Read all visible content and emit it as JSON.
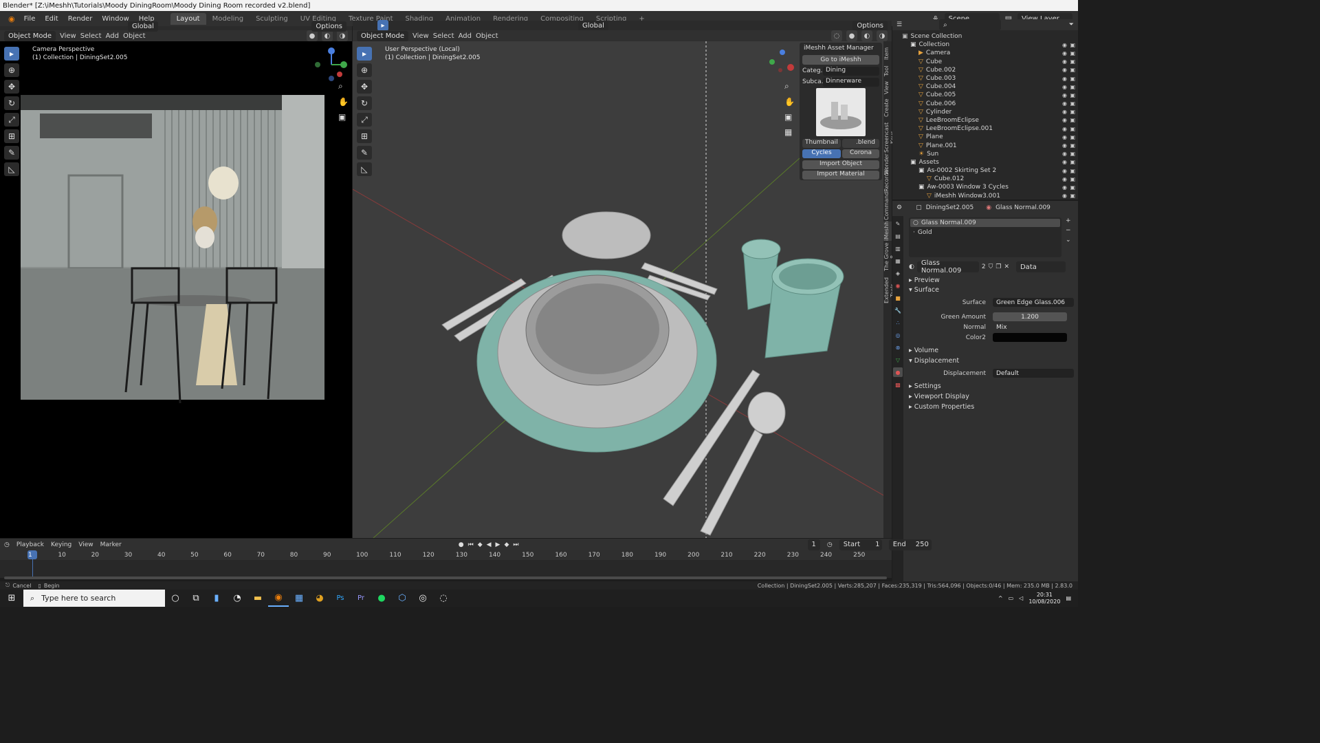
{
  "titlebar": {
    "title": "Blender* [Z:\\iMeshh\\Tutorials\\Moody DiningRoom\\Moody Dining Room recorded v2.blend]",
    "minimize": "—",
    "restore": "❐",
    "close": "✕"
  },
  "menu": [
    "File",
    "Edit",
    "Render",
    "Window",
    "Help"
  ],
  "workspaces": [
    "Layout",
    "Modeling",
    "Sculpting",
    "UV Editing",
    "Texture Paint",
    "Shading",
    "Animation",
    "Rendering",
    "Compositing",
    "Scripting"
  ],
  "active_workspace": "Layout",
  "add_workspace": "+",
  "scene": {
    "label": "Scene",
    "view_layer": "View Layer"
  },
  "left_viewport": {
    "mode": "Object Mode",
    "menus": [
      "View",
      "Select",
      "Add",
      "Object"
    ],
    "transform": "Global",
    "options": "Options",
    "title": "Camera Perspective",
    "subtitle": "(1) Collection | DiningSet2.005"
  },
  "right_viewport": {
    "mode": "Object Mode",
    "menus": [
      "View",
      "Select",
      "Add",
      "Object"
    ],
    "transform": "Global",
    "options": "Options",
    "title": "User Perspective (Local)",
    "subtitle": "(1) Collection | DiningSet2.005"
  },
  "asset_manager": {
    "title": "iMeshh Asset Manager",
    "goto": "Go to iMeshh",
    "category_label": "Categ...",
    "category_value": "Dining",
    "subcategory_label": "Subca...",
    "subcategory_value": "Dinnerware",
    "thumbnail_btn": "Thumbnail",
    "blend_btn": ".blend",
    "engine_cycles": "Cycles",
    "engine_corona": "Corona",
    "import_object": "Import Object",
    "import_material": "Import Material"
  },
  "sidebar_tabs": [
    "Item",
    "Tool",
    "View",
    "Create",
    "Screencast Keys",
    "Wonder",
    "CommandRecorder",
    "iMeshh",
    "The Grove 8",
    "Extended Tools"
  ],
  "outliner": {
    "root": "Scene Collection",
    "items": [
      {
        "name": "Collection",
        "depth": 1,
        "icon": "collection-icon"
      },
      {
        "name": "Camera",
        "depth": 2,
        "icon": "camera-icon"
      },
      {
        "name": "Cube",
        "depth": 2,
        "icon": "mesh-icon"
      },
      {
        "name": "Cube.002",
        "depth": 2,
        "icon": "mesh-icon"
      },
      {
        "name": "Cube.003",
        "depth": 2,
        "icon": "mesh-icon"
      },
      {
        "name": "Cube.004",
        "depth": 2,
        "icon": "mesh-icon"
      },
      {
        "name": "Cube.005",
        "depth": 2,
        "icon": "mesh-icon"
      },
      {
        "name": "Cube.006",
        "depth": 2,
        "icon": "mesh-icon"
      },
      {
        "name": "Cylinder",
        "depth": 2,
        "icon": "mesh-icon"
      },
      {
        "name": "LeeBroomEclipse",
        "depth": 2,
        "icon": "mesh-icon"
      },
      {
        "name": "LeeBroomEclipse.001",
        "depth": 2,
        "icon": "mesh-icon"
      },
      {
        "name": "Plane",
        "depth": 2,
        "icon": "mesh-icon"
      },
      {
        "name": "Plane.001",
        "depth": 2,
        "icon": "mesh-icon"
      },
      {
        "name": "Sun",
        "depth": 2,
        "icon": "light-icon"
      },
      {
        "name": "Assets",
        "depth": 1,
        "icon": "collection-icon"
      },
      {
        "name": "As-0002 Skirting Set 2",
        "depth": 2,
        "icon": "collection-icon"
      },
      {
        "name": "Cube.012",
        "depth": 3,
        "icon": "mesh-icon"
      },
      {
        "name": "Aw-0003 Window 3 Cycles",
        "depth": 2,
        "icon": "collection-icon"
      },
      {
        "name": "iMeshh Window3.001",
        "depth": 3,
        "icon": "mesh-icon"
      }
    ]
  },
  "properties": {
    "object": "DiningSet2.005",
    "material": "Glass Normal.009",
    "slots": [
      "Glass Normal.009",
      "Gold"
    ],
    "material_field": "Glass Normal.009",
    "users": "2",
    "link": "Data",
    "preview": "Preview",
    "surface_section": "Surface",
    "surface_label": "Surface",
    "surface_value": "Green Edge Glass.006",
    "green_label": "Green Amount",
    "green_value": "1.200",
    "normal_label": "Normal",
    "normal_value": "Mix",
    "color2_label": "Color2",
    "volume": "Volume",
    "displacement_section": "Displacement",
    "displacement_label": "Displacement",
    "displacement_value": "Default",
    "settings": "Settings",
    "viewport_display": "Viewport Display",
    "custom_properties": "Custom Properties"
  },
  "timeline": {
    "menus": [
      "Playback",
      "Keying",
      "View",
      "Marker"
    ],
    "current_frame": "1",
    "start_label": "Start",
    "start": "1",
    "end_label": "End",
    "end": "250",
    "ticks": [
      "1",
      "10",
      "20",
      "30",
      "40",
      "50",
      "60",
      "70",
      "80",
      "90",
      "100",
      "110",
      "120",
      "130",
      "140",
      "150",
      "160",
      "170",
      "180",
      "190",
      "200",
      "210",
      "220",
      "230",
      "240",
      "250"
    ]
  },
  "status": {
    "cancel": "Cancel",
    "begin": "Begin",
    "stats": "Collection | DiningSet2.005 | Verts:285,207 | Faces:235,319 | Tris:564,096 | Objects:0/46 | Mem: 235.0 MB | 2.83.0"
  },
  "taskbar": {
    "search_placeholder": "Type here to search",
    "time": "20:31",
    "date": "10/08/2020"
  },
  "colors": {
    "accent": "#4772b3",
    "placemat": "#7fb3a8",
    "viewport_bg": "#3d3d3d"
  }
}
